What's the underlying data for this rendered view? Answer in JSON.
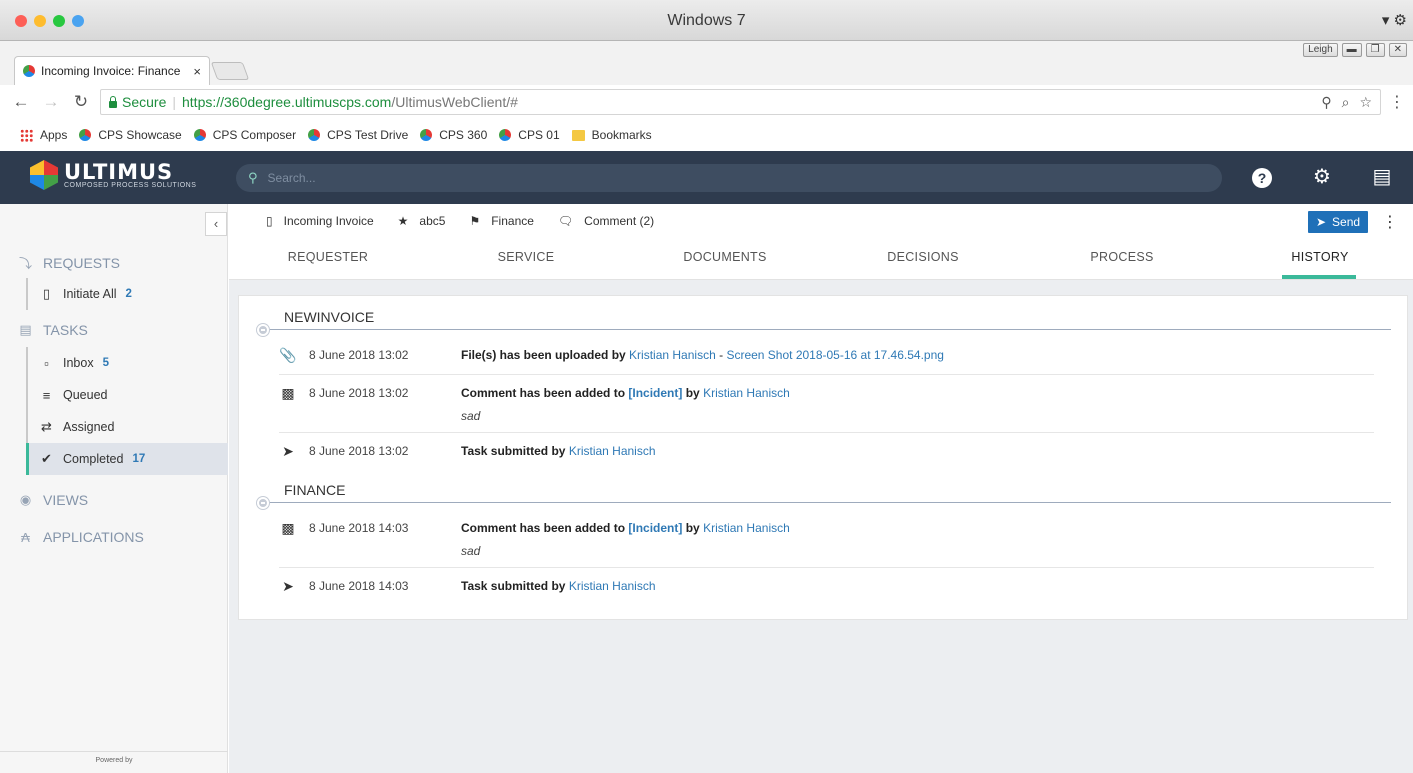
{
  "os": {
    "window_title": "Windows 7",
    "colors": {
      "close": "#fd5f57",
      "minimize": "#febc2e",
      "zoom": "#28c840",
      "extra": "#4aa3f0"
    },
    "right_icons": "▾ ⚙"
  },
  "browser": {
    "user": "Leigh",
    "tab_title": "Incoming Invoice: Finance",
    "tab_close": "×",
    "secure_label": "Secure",
    "url_host": "https://360degree.ultimuscps.com",
    "url_path": "/UltimusWebClient/#",
    "bookmarks": [
      {
        "label": "Apps",
        "icon": "apps-icon"
      },
      {
        "label": "CPS Showcase",
        "icon": "cps-icon"
      },
      {
        "label": "CPS Composer",
        "icon": "cps-icon"
      },
      {
        "label": "CPS Test Drive",
        "icon": "cps-icon"
      },
      {
        "label": "CPS 360",
        "icon": "cps-icon"
      },
      {
        "label": "CPS 01",
        "icon": "cps-icon"
      },
      {
        "label": "Bookmarks",
        "icon": "folder-icon"
      }
    ]
  },
  "app": {
    "logo_text": "ULTIMUS",
    "logo_sub": "COMPOSED PROCESS SOLUTIONS",
    "search_placeholder": "Search...",
    "header_icons": [
      "help-icon",
      "settings-icon",
      "menu-icon"
    ],
    "accent_color": "#3bb99a",
    "header_color": "#2e3b4e"
  },
  "sidebar": {
    "requests_label": "REQUESTS",
    "initiate_label": "Initiate All",
    "initiate_count": "2",
    "tasks_label": "TASKS",
    "inbox_label": "Inbox",
    "inbox_count": "5",
    "queued_label": "Queued",
    "assigned_label": "Assigned",
    "completed_label": "Completed",
    "completed_count": "17",
    "views_label": "VIEWS",
    "applications_label": "APPLICATIONS",
    "powered_label": "Powered by",
    "powered_logo": "ULTIMUS"
  },
  "task": {
    "process": "Incoming Invoice",
    "incident": "abc5",
    "step": "Finance",
    "comment": "Comment (2)",
    "send_label": "Send"
  },
  "tabs": {
    "requester": "REQUESTER",
    "service": "SERVICE",
    "documents": "DOCUMENTS",
    "decisions": "DECISIONS",
    "process": "PROCESS",
    "history": "HISTORY",
    "active": "HISTORY"
  },
  "history": {
    "groups": [
      {
        "title": "NEWINVOICE",
        "entries": [
          {
            "icon": "paperclip-icon",
            "date": "8 June 2018 13:02",
            "action": "File(s) has been uploaded by",
            "user": "Kristian Hanisch",
            "dash": "-",
            "file": "Screen Shot 2018-05-16 at 17.46.54.png"
          },
          {
            "icon": "comment-icon",
            "date": "8 June 2018 13:02",
            "action": "Comment has been added to",
            "incident": "[Incident]",
            "by": "by",
            "user": "Kristian Hanisch",
            "note": "sad"
          },
          {
            "icon": "send-icon",
            "date": "8 June 2018 13:02",
            "action": "Task submitted by",
            "user": "Kristian Hanisch"
          }
        ]
      },
      {
        "title": "FINANCE",
        "entries": [
          {
            "icon": "comment-icon",
            "date": "8 June 2018 14:03",
            "action": "Comment has been added to",
            "incident": "[Incident]",
            "by": "by",
            "user": "Kristian Hanisch",
            "note": "sad"
          },
          {
            "icon": "send-icon",
            "date": "8 June 2018 14:03",
            "action": "Task submitted by",
            "user": "Kristian Hanisch"
          }
        ]
      }
    ]
  }
}
